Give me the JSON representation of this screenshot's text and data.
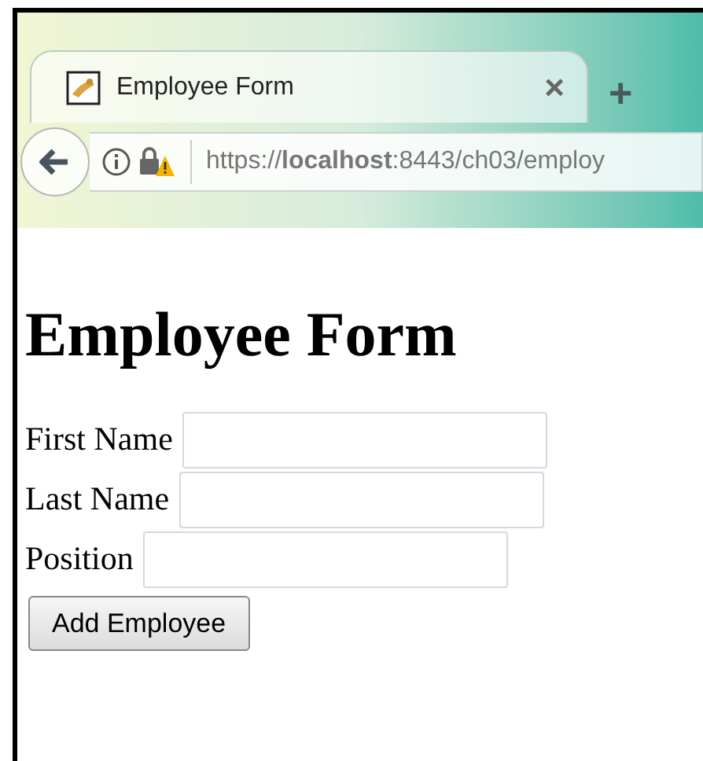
{
  "tab": {
    "title": "Employee Form",
    "close": "×",
    "new_tab": "+"
  },
  "address_bar": {
    "url": "https://**localhost**:8443/ch03/employ"
  },
  "page": {
    "heading": "Employee Form",
    "fields": [
      {
        "label": "First Name"
      },
      {
        "label": "Last Name"
      },
      {
        "label": "Position"
      }
    ],
    "button": "Add Employee"
  }
}
